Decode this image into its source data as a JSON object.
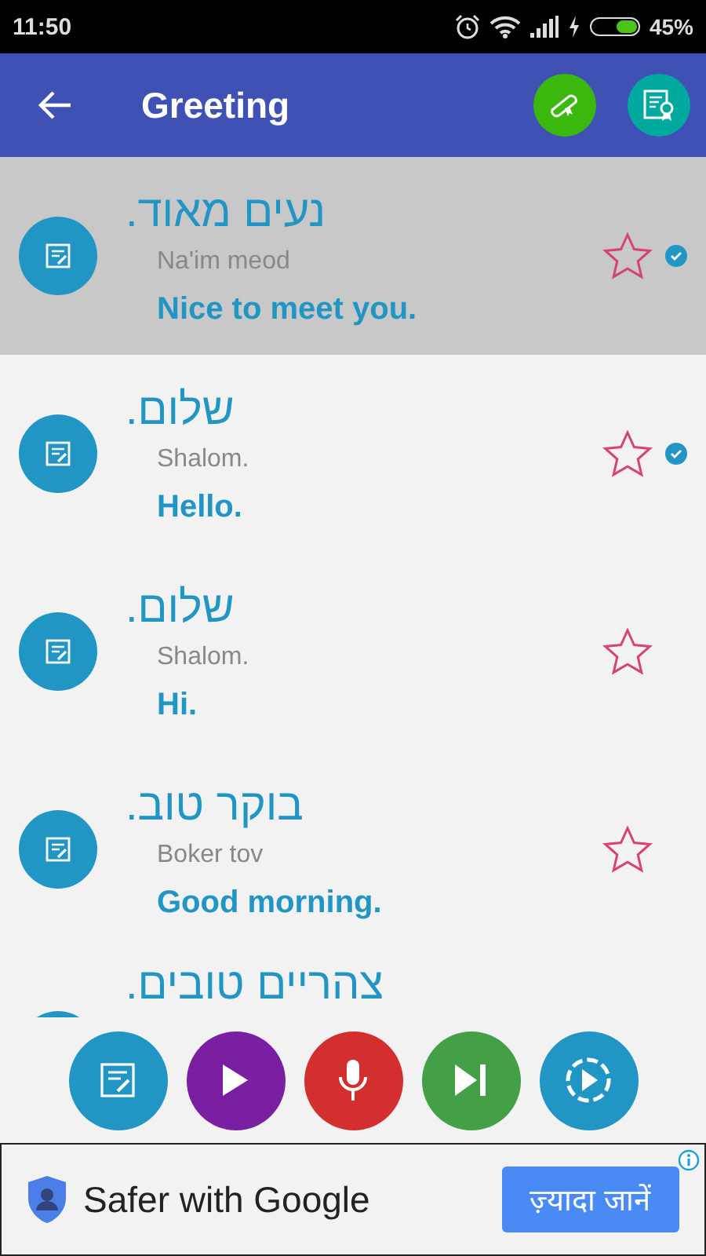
{
  "status_bar": {
    "time": "11:50",
    "battery": "45%"
  },
  "app_bar": {
    "title": "Greeting"
  },
  "phrases": [
    {
      "hebrew": "נעים מאוד.",
      "transliteration": "Na'im meod",
      "english": "Nice to meet you.",
      "selected": true,
      "starred": false,
      "learned": true
    },
    {
      "hebrew": "שלום.",
      "transliteration": "Shalom.",
      "english": "Hello.",
      "selected": false,
      "starred": false,
      "learned": true
    },
    {
      "hebrew": "שלום.",
      "transliteration": "Shalom.",
      "english": "Hi.",
      "selected": false,
      "starred": false,
      "learned": false
    },
    {
      "hebrew": "בוקר טוב.",
      "transliteration": "Boker tov",
      "english": "Good morning.",
      "selected": false,
      "starred": false,
      "learned": false
    },
    {
      "hebrew": "צהריים טובים.",
      "selected": false
    }
  ],
  "controls": [
    {
      "kind": "notes",
      "color": "#2196c4"
    },
    {
      "kind": "play",
      "color": "#7b1fa2"
    },
    {
      "kind": "mic",
      "color": "#d32f2f"
    },
    {
      "kind": "next",
      "color": "#43a047"
    },
    {
      "kind": "autoplay",
      "color": "#2196c4"
    }
  ],
  "ad": {
    "headline": "Safer with Google",
    "button": "ज़्यादा जानें"
  }
}
